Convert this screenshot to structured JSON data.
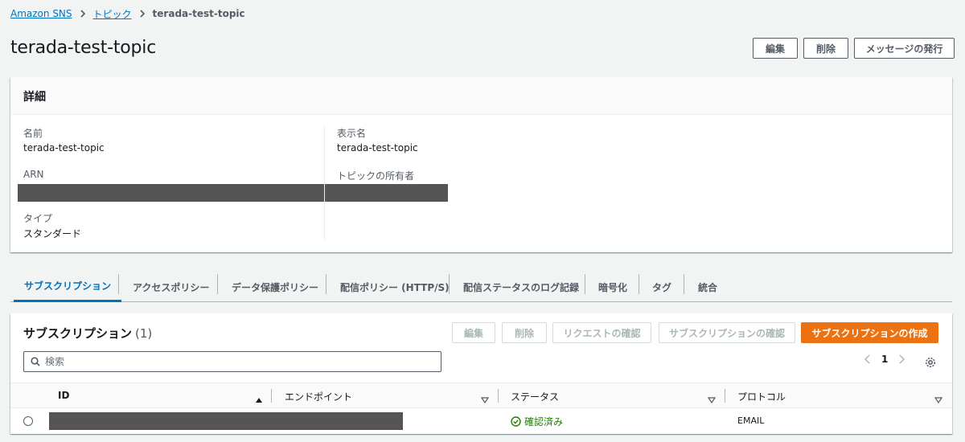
{
  "breadcrumb": {
    "root": "Amazon SNS",
    "parent": "トピック",
    "current": "terada-test-topic"
  },
  "page": {
    "title": "terada-test-topic",
    "actions": {
      "edit": "編集",
      "delete": "削除",
      "publish": "メッセージの発行"
    }
  },
  "details": {
    "heading": "詳細",
    "name_label": "名前",
    "name_value": "terada-test-topic",
    "arn_label": "ARN",
    "type_label": "タイプ",
    "type_value": "スタンダード",
    "display_name_label": "表示名",
    "display_name_value": "terada-test-topic",
    "owner_label": "トピックの所有者"
  },
  "tabs": [
    {
      "label": "サブスクリプション"
    },
    {
      "label": "アクセスポリシー"
    },
    {
      "label": "データ保護ポリシー"
    },
    {
      "label": "配信ポリシー (HTTP/S)"
    },
    {
      "label": "配信ステータスのログ記録"
    },
    {
      "label": "暗号化"
    },
    {
      "label": "タグ"
    },
    {
      "label": "統合"
    }
  ],
  "subscriptions": {
    "title": "サブスクリプション",
    "count": "(1)",
    "buttons": {
      "edit": "編集",
      "delete": "削除",
      "confirm_request": "リクエストの確認",
      "confirm_subscription": "サブスクリプションの確認",
      "create": "サブスクリプションの作成"
    },
    "search_placeholder": "検索",
    "page_number": "1",
    "columns": {
      "id": "ID",
      "endpoint": "エンドポイント",
      "status": "ステータス",
      "protocol": "プロトコル"
    },
    "rows": [
      {
        "status": "確認済み",
        "protocol": "EMAIL"
      }
    ]
  },
  "colors": {
    "link": "#0073bb",
    "primary": "#ec7211",
    "success": "#1d8102"
  }
}
